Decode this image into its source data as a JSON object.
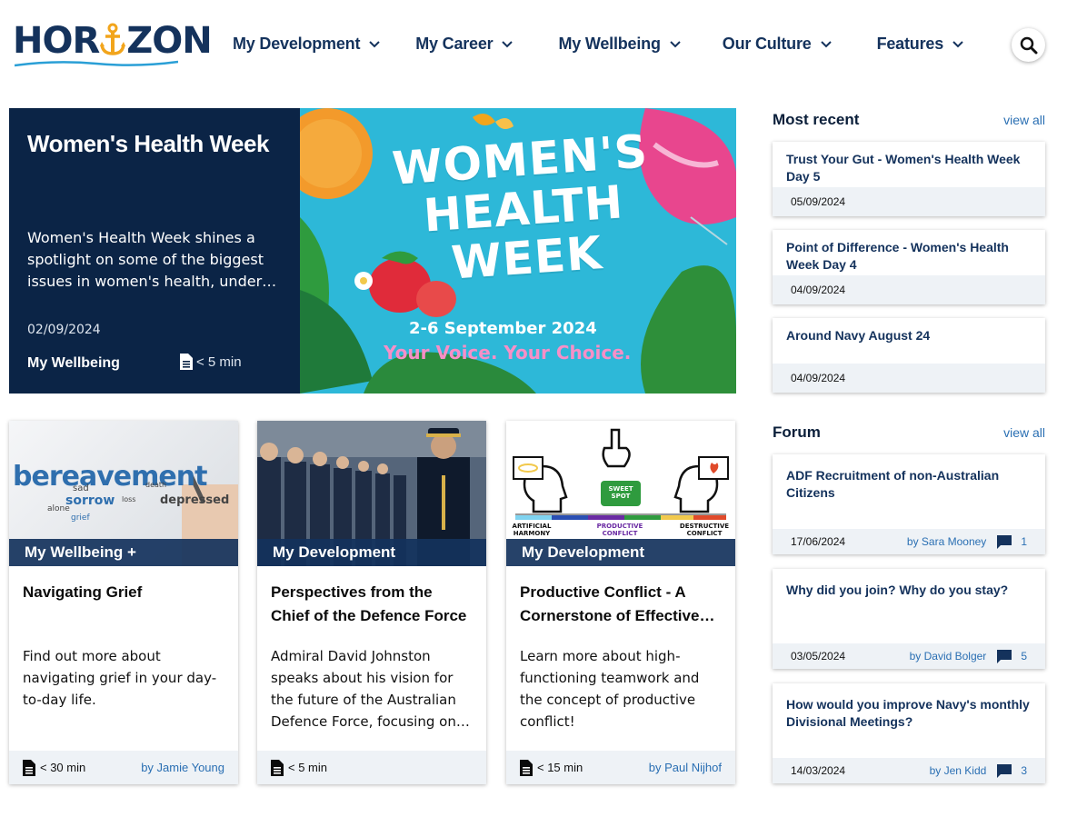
{
  "brand": {
    "logo_left": "HOR",
    "logo_right": "ZON",
    "navy": "#14325c",
    "gold": "#f2a51c"
  },
  "nav": [
    {
      "label": "My Development"
    },
    {
      "label": "My Career"
    },
    {
      "label": "My Wellbeing"
    },
    {
      "label": "Our Culture"
    },
    {
      "label": "Features"
    }
  ],
  "hero": {
    "title": "Women's Health Week",
    "description": "Women's Health Week shines a spotlight on some of the biggest issues in women's health, under the theme Your Voice. Your Choice.",
    "date": "02/09/2024",
    "category": "My Wellbeing",
    "read_time": "< 5 min",
    "image": {
      "title_line1": "WOMEN'S",
      "title_line2": "HEALTH",
      "title_line3": "WEEK",
      "dates": "2-6 September 2024",
      "slogan": "Your Voice. Your Choice."
    }
  },
  "cards": [
    {
      "tag": "My Wellbeing +",
      "title": "Navigating Grief",
      "description": "Find out more about navigating grief in your day-to-day life.",
      "read_time": "< 30 min",
      "author": "by Jamie Young",
      "image_words": [
        "bereavement",
        "sorrow",
        "depressed",
        "sad",
        "grief",
        "alone",
        "death",
        "loss"
      ]
    },
    {
      "tag": "My Development",
      "title": "Perspectives from the Chief of the Defence Force",
      "description": "Admiral David Johnston speaks about his vision for the future of the Australian Defence Force, focusing on people and capability.",
      "read_time": "< 5 min",
      "author": ""
    },
    {
      "tag": "My Development",
      "title": "Productive Conflict - A Cornerstone of Effective Teams",
      "description": "Learn more about high-functioning teamwork and the concept of productive conflict!",
      "read_time": "< 15 min",
      "author": "by Paul Nijhof",
      "image_labels": [
        "SWEET SPOT",
        "ARTIFICIAL HARMONY",
        "PRODUCTIVE CONFLICT",
        "DESTRUCTIVE CONFLICT"
      ]
    }
  ],
  "most_recent": {
    "title": "Most recent",
    "link": "view all",
    "items": [
      {
        "title": "Trust Your Gut - Women's Health Week Day 5",
        "date": "05/09/2024"
      },
      {
        "title": "Point of Difference - Women's Health Week Day 4",
        "date": "04/09/2024"
      },
      {
        "title": "Around Navy August 24",
        "date": "04/09/2024"
      }
    ]
  },
  "forum": {
    "title": "Forum",
    "link": "view all",
    "items": [
      {
        "title": "ADF Recruitment of non-Australian Citizens",
        "date": "17/06/2024",
        "author": "by Sara Mooney",
        "comments": "1"
      },
      {
        "title": "Why did you join? Why do you stay?",
        "date": "03/05/2024",
        "author": "by David Bolger",
        "comments": "5"
      },
      {
        "title": "How would you improve Navy's monthly Divisional Meetings?",
        "date": "14/03/2024",
        "author": "by Jen Kidd",
        "comments": "3"
      }
    ]
  }
}
